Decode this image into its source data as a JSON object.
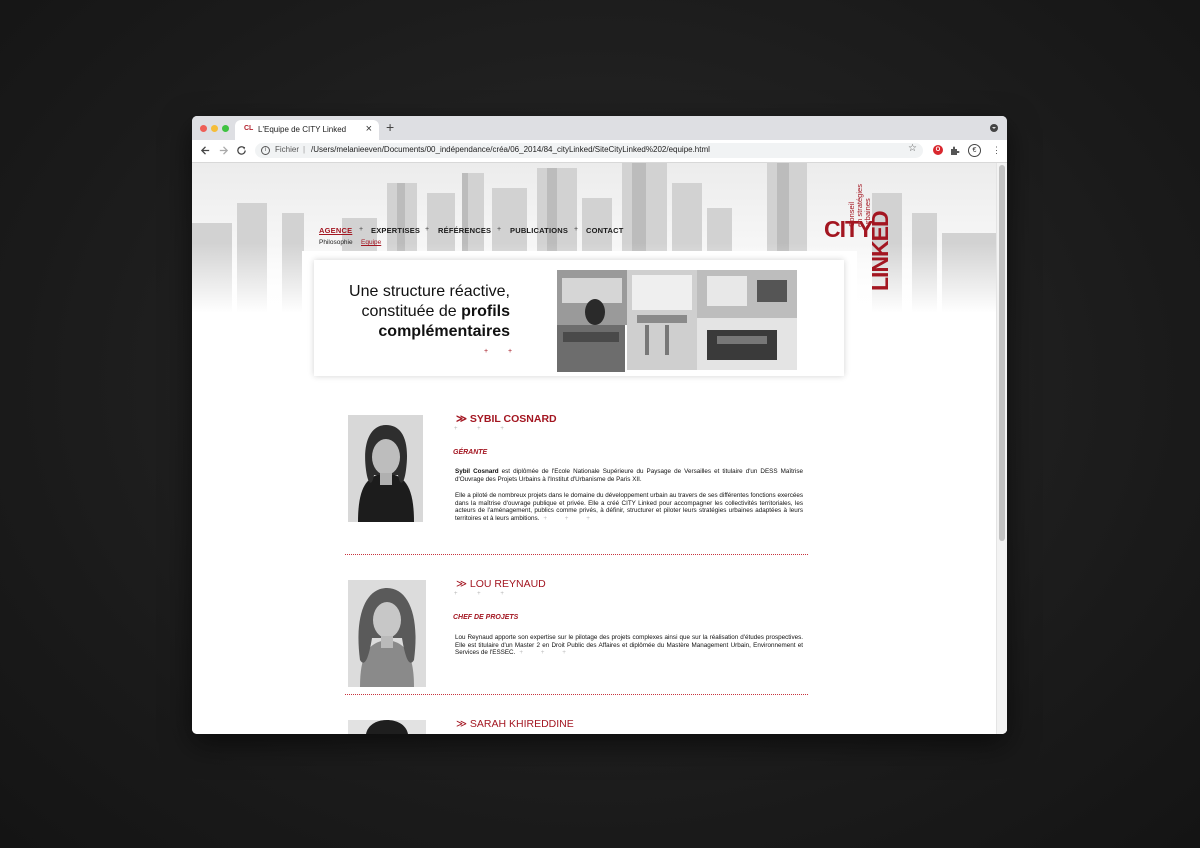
{
  "browser": {
    "tab_title": "L'Equipe de CITY Linked",
    "favicon_text": "CL",
    "close_glyph": "×",
    "newtab_glyph": "+",
    "scheme_label": "Fichier",
    "url": "/Users/melanieeven/Documents/00_indépendance/créa/06_2014/84_cityLinked/SiteCityLinked%202/equipe.html",
    "icons": [
      "back-arrow-icon",
      "forward-arrow-icon",
      "reload-icon",
      "info-icon",
      "star-icon",
      "opera-icon",
      "puzzle-icon",
      "avatar-icon",
      "menu-icon"
    ]
  },
  "site": {
    "brand_color": "#a31621",
    "logo": {
      "city": "CITY",
      "linked": "LINKED",
      "tagline_lines": [
        "Conseil",
        "en stratégies",
        "urbaines"
      ]
    },
    "nav": [
      {
        "label": "AGENCE",
        "active": true
      },
      {
        "label": "EXPERTISES",
        "active": false
      },
      {
        "label": "RÉFÉRENCES",
        "active": false
      },
      {
        "label": "PUBLICATIONS",
        "active": false
      },
      {
        "label": "CONTACT",
        "active": false
      }
    ],
    "subnav": [
      {
        "label": "Philosophie",
        "active": false
      },
      {
        "label": "Equipe",
        "active": true
      }
    ],
    "banner": {
      "line1": "Une structure réactive,",
      "line2_pre": "constituée de ",
      "line2_bold": "profils",
      "line3_bold": "complémentaires",
      "plus": "+ +"
    },
    "team": [
      {
        "name": "≫ SYBIL COSNARD",
        "pluses": "+ + +",
        "role": "GÉRANTE",
        "bio_p1_bold": "Sybil Cosnard",
        "bio_p1": " est diplômée de l'Ecole Nationale Supérieure du Paysage de Versailles et titulaire d'un DESS Maîtrise d'Ouvrage des Projets Urbains à l'Institut d'Urbanisme de Paris XII.",
        "bio_p2": "Elle a piloté de nombreux projets dans le domaine du développement urbain au travers de ses différentes fonctions exercées dans la maîtrise d'ouvrage publique et privée.  Elle a créé CITY Linked pour accompagner les collectivités territoriales, les acteurs de l'aménagement, publics comme privés,  à définir, structurer et piloter leurs stratégies urbaines adaptées à leurs territoires et à leurs ambitions.",
        "end_plus": "+ + +"
      },
      {
        "name": "≫ LOU REYNAUD",
        "pluses": "+ + +",
        "role": "CHEF DE PROJETS",
        "bio_p1": "Lou Reynaud apporte son expertise sur le pilotage des projets complexes ainsi que sur la réalisation d'études prospectives. Elle est titulaire d'un Master 2 en Droit Public des Affaires et diplômée du Mastère Management Urbain, Environnement et Services de l'ESSEC.",
        "end_plus": "+ + +"
      },
      {
        "name": "≫ SARAH KHIREDDINE"
      }
    ]
  }
}
